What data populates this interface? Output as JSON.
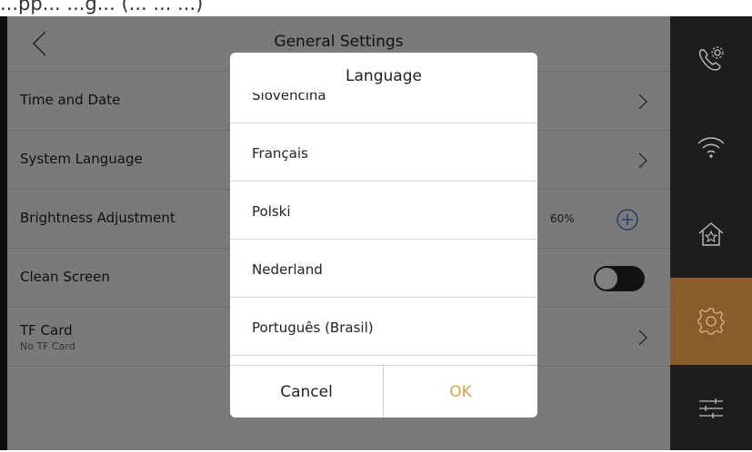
{
  "caption": "...pp... ...g... (... ... ...)",
  "page": {
    "title": "General Settings"
  },
  "settings": [
    {
      "label": "Time and Date",
      "sub": "",
      "control": "chevron"
    },
    {
      "label": "System Language",
      "sub": "",
      "control": "chevron"
    },
    {
      "label": "Brightness Adjustment",
      "sub": "",
      "value": "60%",
      "control": "plus"
    },
    {
      "label": "Clean Screen",
      "sub": "",
      "control": "toggle",
      "state": "off"
    },
    {
      "label": "TF Card",
      "sub": "No TF Card",
      "control": "chevron"
    }
  ],
  "dialog": {
    "title": "Language",
    "options": [
      "Slovenčina",
      "Français",
      "Polski",
      "Nederland",
      "Português (Brasil)"
    ],
    "cancel_label": "Cancel",
    "ok_label": "OK"
  },
  "sidebar": {
    "items": [
      {
        "icon": "phone-settings-icon",
        "active": false
      },
      {
        "icon": "wifi-icon",
        "active": false
      },
      {
        "icon": "home-icon",
        "active": false
      },
      {
        "icon": "gear-icon",
        "active": true
      },
      {
        "icon": "sliders-icon",
        "active": false
      }
    ]
  },
  "colors": {
    "accent": "#e0a040",
    "active_sidebar": "#8a5c2c",
    "sidebar_bg": "#1d1d1d",
    "background": "#f4f4f4"
  }
}
